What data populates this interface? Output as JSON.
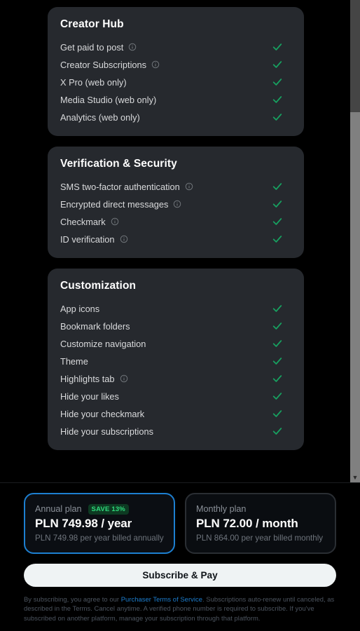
{
  "feature_sections": [
    {
      "title": "Creator Hub",
      "features": [
        {
          "label": "Get paid to post",
          "info": true,
          "included": true
        },
        {
          "label": "Creator Subscriptions",
          "info": true,
          "included": true
        },
        {
          "label": "X Pro (web only)",
          "info": false,
          "included": true
        },
        {
          "label": "Media Studio (web only)",
          "info": false,
          "included": true
        },
        {
          "label": "Analytics (web only)",
          "info": false,
          "included": true
        }
      ]
    },
    {
      "title": "Verification & Security",
      "features": [
        {
          "label": "SMS two-factor authentication",
          "info": true,
          "included": true
        },
        {
          "label": "Encrypted direct messages",
          "info": true,
          "included": true
        },
        {
          "label": "Checkmark",
          "info": true,
          "included": true
        },
        {
          "label": "ID verification",
          "info": true,
          "included": true
        }
      ]
    },
    {
      "title": "Customization",
      "features": [
        {
          "label": "App icons",
          "info": false,
          "included": true
        },
        {
          "label": "Bookmark folders",
          "info": false,
          "included": true
        },
        {
          "label": "Customize navigation",
          "info": false,
          "included": true
        },
        {
          "label": "Theme",
          "info": false,
          "included": true
        },
        {
          "label": "Highlights tab",
          "info": true,
          "included": true
        },
        {
          "label": "Hide your likes",
          "info": false,
          "included": true
        },
        {
          "label": "Hide your checkmark",
          "info": false,
          "included": true
        },
        {
          "label": "Hide your subscriptions",
          "info": false,
          "included": true
        }
      ]
    }
  ],
  "scrollbar": {
    "down_arrow_glyph": "▼"
  },
  "checkout": {
    "plans": [
      {
        "name": "Annual plan",
        "badge": "SAVE 13%",
        "price": "PLN 749.98 / year",
        "sub": "PLN 749.98 per year billed annually",
        "selected": true
      },
      {
        "name": "Monthly plan",
        "badge": "",
        "price": "PLN 72.00 / month",
        "sub": "PLN 864.00 per year billed monthly",
        "selected": false
      }
    ],
    "subscribe_label": "Subscribe & Pay",
    "legal": {
      "pre": "By subscribing, you agree to our ",
      "link": "Purchaser Terms of Service",
      "post": ". Subscriptions auto-renew until canceled, as described in the Terms. Cancel anytime. A verified phone number is required to subscribe. If you've subscribed on another platform, manage your subscription through that platform."
    }
  },
  "colors": {
    "background": "#000000",
    "card": "#26292e",
    "check_green": "#17a160",
    "accent_blue": "#1d7fd0",
    "badge_green": "#2fd97b",
    "button_light": "#eff3f4"
  },
  "icons": {
    "info": "info-circle-icon",
    "check": "checkmark-icon"
  }
}
